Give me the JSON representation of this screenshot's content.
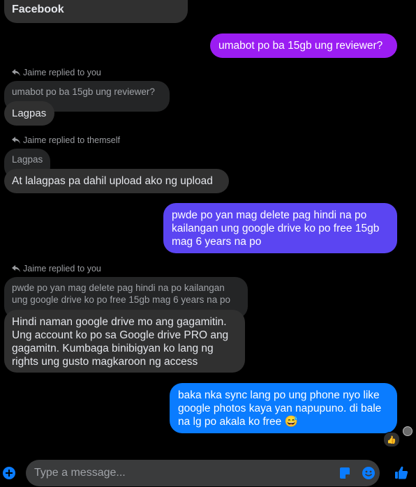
{
  "header": {
    "title": "Facebook"
  },
  "messages": [
    {
      "type": "out",
      "text": "umabot po ba 15gb ung reviewer?"
    },
    {
      "type": "reply_label",
      "text": "Jaime replied to you"
    },
    {
      "type": "quoted",
      "text": "umabot po ba 15gb ung reviewer?"
    },
    {
      "type": "in",
      "text": "Lagpas"
    },
    {
      "type": "reply_label",
      "text": "Jaime replied to themself"
    },
    {
      "type": "quoted",
      "text": "Lagpas"
    },
    {
      "type": "in",
      "text": "At lalagpas pa dahil upload ako ng upload"
    },
    {
      "type": "out",
      "text": "pwde po yan mag delete pag hindi na po kailangan ung google drive ko po free 15gb mag 6 years na po"
    },
    {
      "type": "reply_label",
      "text": "Jaime replied to you"
    },
    {
      "type": "quoted",
      "text": "pwde po yan mag delete pag hindi na po kailangan ung google drive ko po free 15gb mag 6 years na po"
    },
    {
      "type": "in",
      "text": "Hindi naman google drive mo ang gagamitin. Ung account ko po sa Google drive PRO ang gagamitn. Kumbaga binibigyan ko lang ng rights ung gusto magkaroon ng access"
    },
    {
      "type": "out",
      "text": "baka nka sync lang po ung phone nyo like google photos kaya yan napupuno. di bale na lg po akala ko free 😅"
    }
  ],
  "reaction": {
    "icon": "thumbs-up-icon",
    "emoji": "👍"
  },
  "composer": {
    "placeholder": "Type a message..."
  },
  "colors": {
    "out_top": "#a020f0",
    "out_mid": "#5b45f2",
    "out_bottom": "#0a7cff",
    "in": "#303030",
    "accent": "#0a7cff"
  },
  "icons": [
    "reply-arrow-icon",
    "add-icon",
    "sticker-icon",
    "emoji-icon",
    "thumbs-up-icon",
    "seen-avatar-icon"
  ]
}
